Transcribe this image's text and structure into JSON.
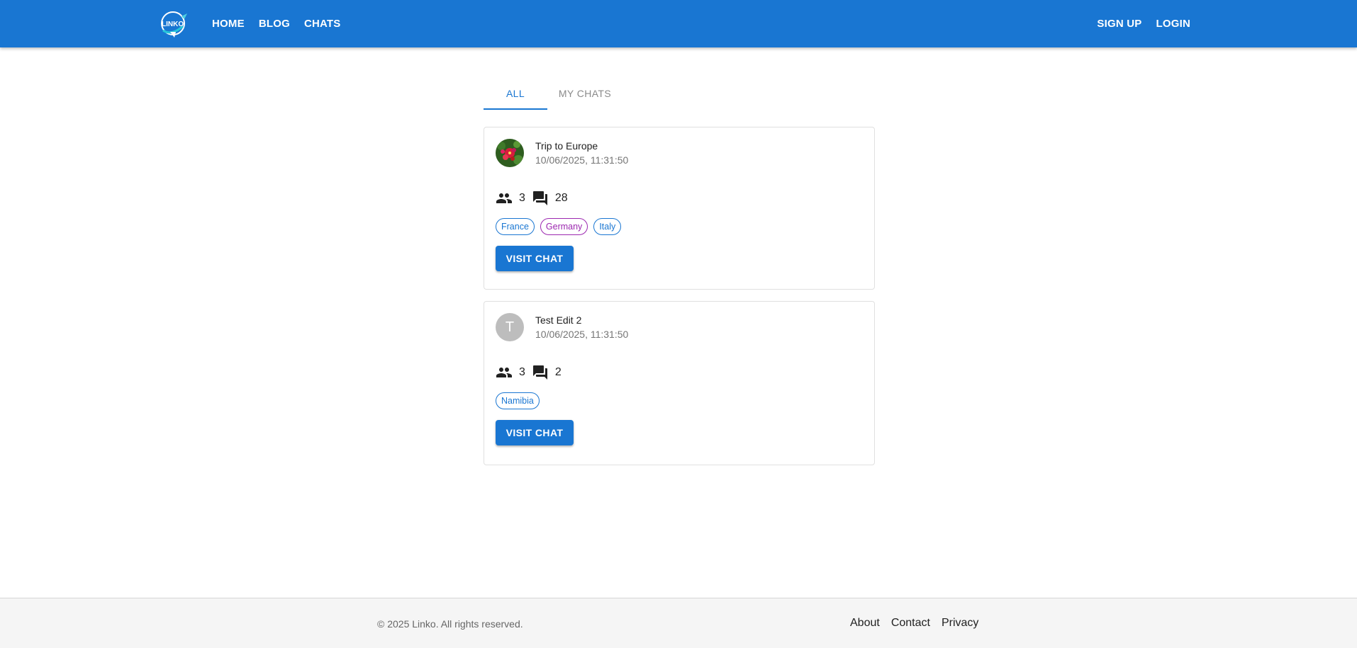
{
  "header": {
    "logo_text": "LINKO",
    "nav": [
      "HOME",
      "BLOG",
      "CHATS"
    ],
    "auth": [
      "SIGN UP",
      "LOGIN"
    ]
  },
  "tabs": [
    {
      "label": "ALL",
      "active": true
    },
    {
      "label": "MY CHATS",
      "active": false
    }
  ],
  "chats": [
    {
      "title": "Trip to Europe",
      "timestamp": "10/06/2025, 11:31:50",
      "avatar": "flower-image",
      "members": "3",
      "messages": "28",
      "tags": [
        {
          "label": "France",
          "color": "#1976d2"
        },
        {
          "label": "Germany",
          "color": "#9c27b0"
        },
        {
          "label": "Italy",
          "color": "#1976d2"
        }
      ],
      "button": "VISIT CHAT"
    },
    {
      "title": "Test Edit 2",
      "timestamp": "10/06/2025, 11:31:50",
      "avatar_letter": "T",
      "members": "3",
      "messages": "2",
      "tags": [
        {
          "label": "Namibia",
          "color": "#1976d2"
        }
      ],
      "button": "VISIT CHAT"
    }
  ],
  "footer": {
    "copyright": "© 2025 Linko. All rights reserved.",
    "links": [
      "About",
      "Contact",
      "Privacy"
    ]
  },
  "colors": {
    "primary": "#1976d2",
    "secondary": "#9c27b0",
    "footer_bg": "#f5f5f5"
  }
}
